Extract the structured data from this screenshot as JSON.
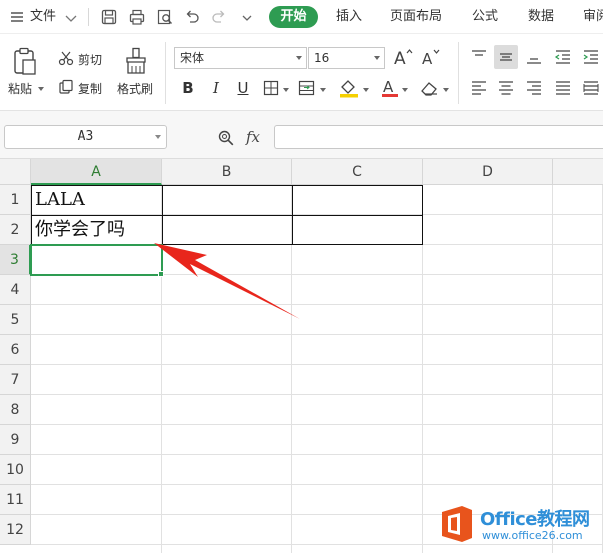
{
  "menubar": {
    "file_label": "文件",
    "tabs": [
      {
        "label": "开始",
        "active": true
      },
      {
        "label": "插入"
      },
      {
        "label": "页面布局"
      },
      {
        "label": "公式"
      },
      {
        "label": "数据"
      },
      {
        "label": "审阅"
      }
    ],
    "quick_icons": [
      "save-icon",
      "print-icon",
      "print-preview-icon",
      "undo-icon",
      "redo-icon",
      "dropdown-icon"
    ],
    "accent_color": "#2e9c52"
  },
  "ribbon": {
    "paste_label": "粘贴",
    "cut_label": "剪切",
    "copy_label": "复制",
    "format_painter_label": "格式刷",
    "font_name": "宋体",
    "font_size": "16",
    "font_color": "#e53935",
    "highlight_color": "#f5d000"
  },
  "formula_bar": {
    "cell_ref": "A3",
    "fx_label": "fx",
    "formula": ""
  },
  "grid": {
    "columns": [
      "A",
      "B",
      "C",
      "D"
    ],
    "rows": [
      "1",
      "2",
      "3",
      "4",
      "5",
      "6",
      "7",
      "8",
      "9",
      "10",
      "11",
      "12"
    ],
    "active_column": "A",
    "active_row": "3",
    "cells": {
      "A1": "LALA",
      "A2": "你学会了吗"
    }
  },
  "watermark": {
    "brand": "Office教程网",
    "url": "www.office26.com"
  }
}
